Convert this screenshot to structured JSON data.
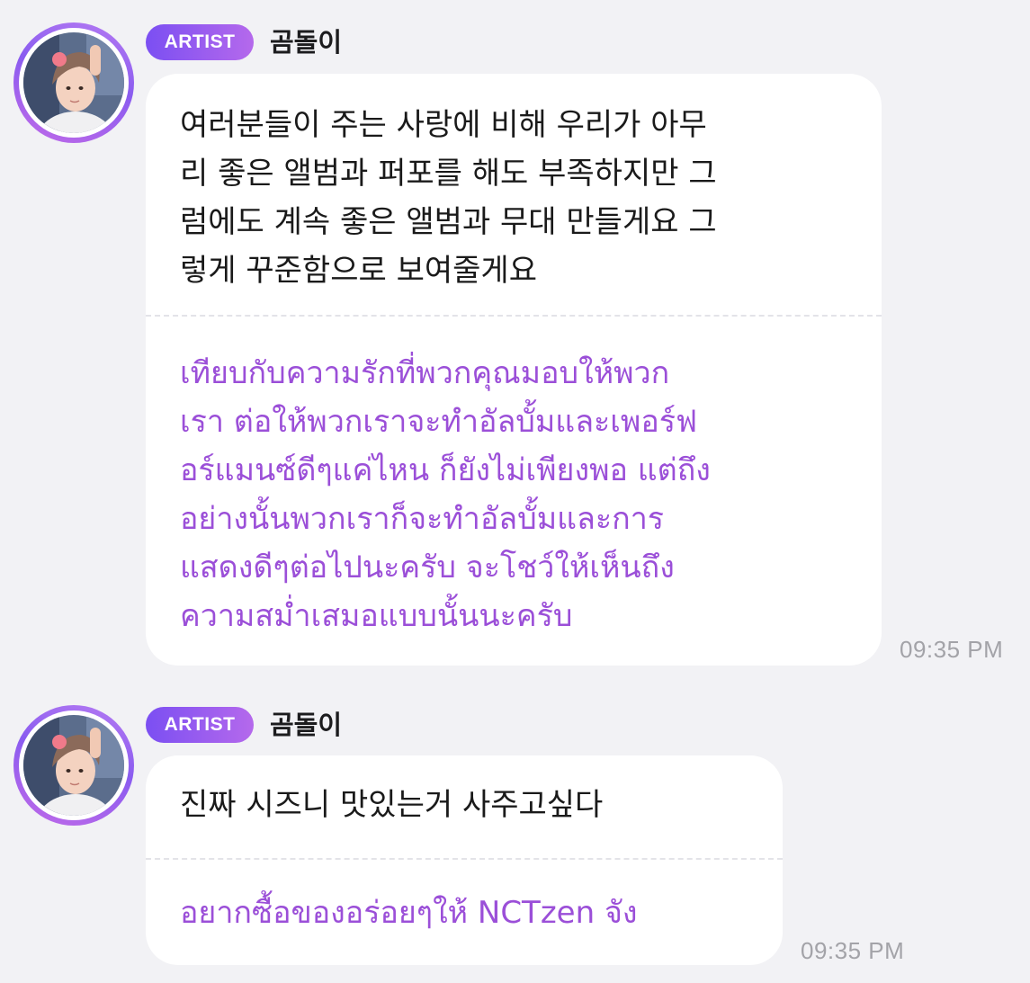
{
  "messages": [
    {
      "badge": "ARTIST",
      "author": "곰돌이",
      "original": "여러분들이 주는 사랑에 비해 우리가 아무\n리 좋은 앨범과 퍼포를 해도 부족하지만 그\n럼에도 계속 좋은 앨범과 무대 만들게요 그\n렇게 꾸준함으로 보여줄게요",
      "translation": "เทียบกับความรักที่พวกคุณมอบให้พวก\nเรา ต่อให้พวกเราจะทำอัลบั้มและเพอร์ฟ\nอร์แมนซ์ดีๆแค่ไหน ก็ยังไม่เพียงพอ แต่ถึง\nอย่างนั้นพวกเราก็จะทำอัลบั้มและการ\nแสดงดีๆต่อไปนะครับ จะโชว์ให้เห็นถึง\nความสม่ำเสมอแบบนั้นนะครับ",
      "time": "09:35 PM"
    },
    {
      "badge": "ARTIST",
      "author": "곰돌이",
      "original": "진짜 시즈니 맛있는거 사주고싶다",
      "translation": "อยากซื้อของอร่อยๆให้ NCTzen จัง",
      "time": "09:35 PM"
    }
  ],
  "colors": {
    "background": "#f2f2f5",
    "bubble": "#ffffff",
    "translation_text": "#9b4fd8",
    "badge_start": "#7b4ff2",
    "badge_end": "#b569ec",
    "timestamp": "#a3a3a8"
  },
  "icons": {
    "avatar": "artist-profile-photo"
  }
}
